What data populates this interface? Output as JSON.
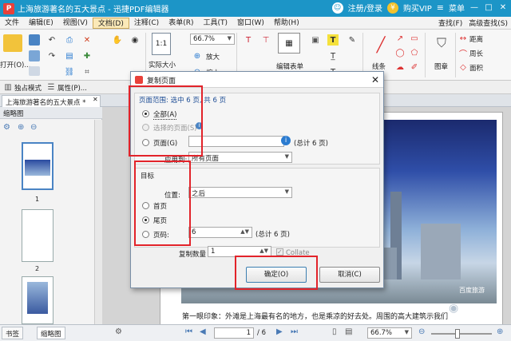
{
  "window": {
    "title": "上海旅游著名的五大景点 - 迅捷PDF编辑器",
    "logo": "P",
    "login": "注册/登录",
    "buy": "购买VIP",
    "menu": "菜单"
  },
  "menubar": {
    "items": [
      "文件",
      "编辑(E)",
      "视图(V)",
      "文档(D)",
      "注释(C)",
      "表单(R)",
      "工具(T)",
      "窗口(W)",
      "帮助(H)"
    ],
    "active_index": 3,
    "right": [
      "查找(F)",
      "高级查找(S)"
    ]
  },
  "ribbon": {
    "open": "打开(O)...",
    "actual_size": "实际大小",
    "zoom_value": "66.7%",
    "zoom_in": "放大",
    "zoom_out": "缩小",
    "edit_form": "编辑表单",
    "line": "线条",
    "stamp": "图章",
    "distance": "距离",
    "perimeter": "周长",
    "area": "面积"
  },
  "quickbar": {
    "single_mode": "独占模式",
    "properties": "属性(P)..."
  },
  "doc_tab": "上海旅游著名的五大景点 *",
  "thumbnail_panel": {
    "title": "缩略图",
    "pages": [
      "1",
      "2"
    ]
  },
  "document": {
    "watermark": "百度旅游",
    "text": "第一眼印象：外滩是上海最有名的地方，也是乘凉的好去处。周围的高大建筑示我们"
  },
  "statusbar": {
    "tabs": [
      "书签",
      "缩略图"
    ],
    "page": "1",
    "total": "/ 6",
    "zoom": "66.7%"
  },
  "dialog": {
    "title": "复制页面",
    "range_label": "页面范围: 选中 6 页, 共 6 页",
    "all": "全部(A)",
    "selected": "选择的页面(S)",
    "pages": "页面(G)",
    "pages_total": "(总计 6 页)",
    "apply_label": "应用到:",
    "apply_value": "所有页面",
    "target_label": "目标",
    "position_label": "位置:",
    "position_value": "之后",
    "first": "首页",
    "last": "尾页",
    "page_num": "页码:",
    "page_num_value": "6",
    "page_num_total": "(总计 6 页)",
    "copies_label": "复制数量",
    "copies_value": "1",
    "collate": "Collate",
    "ok": "确定(O)",
    "cancel": "取消(C)"
  },
  "colors": {
    "titlebar": "#1c95c7",
    "highlight": "#e2232a"
  }
}
